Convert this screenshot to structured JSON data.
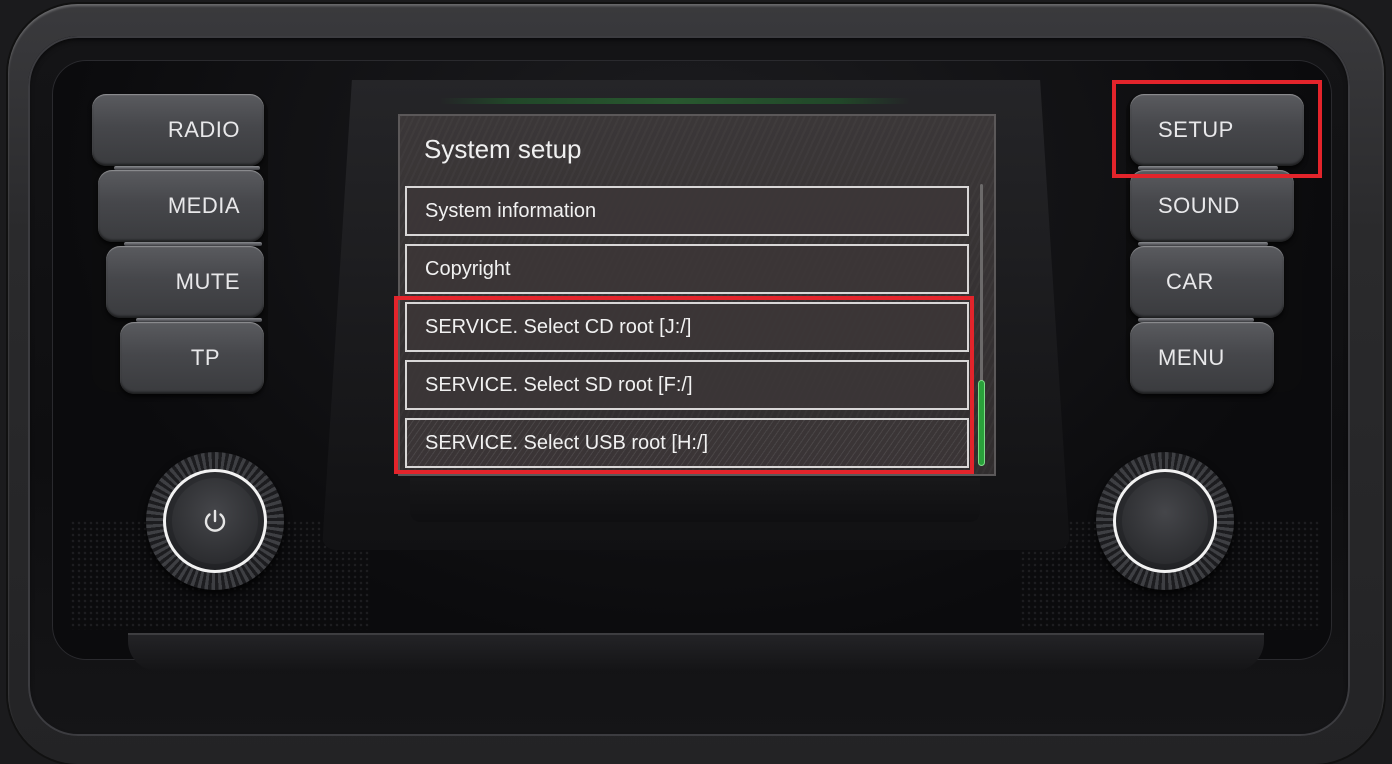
{
  "screen": {
    "title": "System setup",
    "items": [
      {
        "label": "System information"
      },
      {
        "label": "Copyright"
      },
      {
        "label": "SERVICE. Select CD root [J:/]"
      },
      {
        "label": "SERVICE. Select SD root [F:/]"
      },
      {
        "label": "SERVICE. Select USB root [H:/]"
      }
    ]
  },
  "left_buttons": [
    {
      "label": "RADIO"
    },
    {
      "label": "MEDIA"
    },
    {
      "label": "MUTE"
    },
    {
      "label": "TP"
    }
  ],
  "right_buttons": [
    {
      "label": "SETUP"
    },
    {
      "label": "SOUND"
    },
    {
      "label": "CAR"
    },
    {
      "label": "MENU"
    }
  ],
  "knobs": {
    "left_icon": "power-icon",
    "right_icon": "none"
  },
  "colors": {
    "highlight": "#e3242b",
    "scroll_thumb": "#2aa13b"
  }
}
